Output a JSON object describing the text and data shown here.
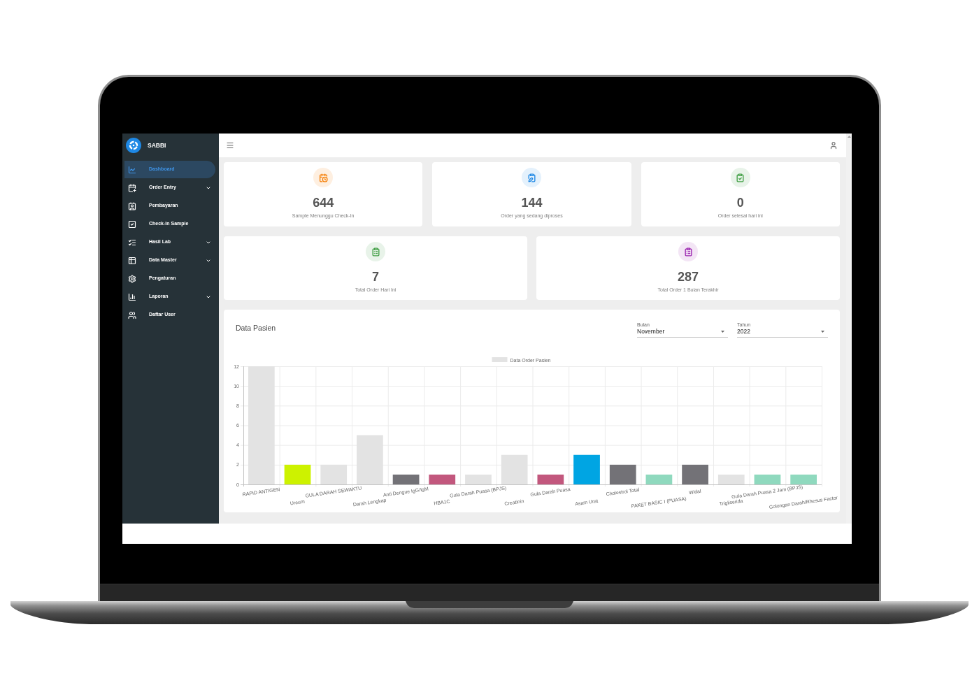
{
  "sidebar": {
    "brand": "SABBI",
    "items": [
      {
        "label": "Dashboard",
        "selected": true,
        "has_submenu": false
      },
      {
        "label": "Order Entry",
        "selected": false,
        "has_submenu": true
      },
      {
        "label": "Pembayaran",
        "selected": false,
        "has_submenu": false
      },
      {
        "label": "Check-in Sample",
        "selected": false,
        "has_submenu": false
      },
      {
        "label": "Hasil Lab",
        "selected": false,
        "has_submenu": true
      },
      {
        "label": "Data Master",
        "selected": false,
        "has_submenu": true
      },
      {
        "label": "Pengaturan",
        "selected": false,
        "has_submenu": false
      },
      {
        "label": "Laporan",
        "selected": false,
        "has_submenu": true
      },
      {
        "label": "Daftar User",
        "selected": false,
        "has_submenu": false
      }
    ]
  },
  "stat_rows": [
    {
      "cards": [
        {
          "value": "644",
          "label": "Sample Menunggu Check-In",
          "color": "#f57c00"
        },
        {
          "value": "144",
          "label": "Order yang sedang diproses",
          "color": "#1e88e5"
        },
        {
          "value": "0",
          "label": "Order selesai hari ini",
          "color": "#43a047"
        }
      ]
    },
    {
      "cards": [
        {
          "value": "7",
          "label": "Total Order Hari Ini",
          "color": "#43a047"
        },
        {
          "value": "287",
          "label": "Total Order 1 Bulan Terakhir",
          "color": "#9c27b0"
        }
      ]
    }
  ],
  "chart_panel": {
    "title": "Data Pasien",
    "filters": [
      {
        "label": "Bulan",
        "value": "November"
      },
      {
        "label": "Tahun",
        "value": "2022"
      }
    ],
    "chart_data": {
      "type": "bar",
      "categories": [
        "RAPID ANTIGEN",
        "Ureum",
        "GULA DARAH SEWAKTU",
        "Darah Lengkap",
        "Anti Dengue IgG/IgM",
        "HBA1C",
        "Gula Darah Puasa (BPJS)",
        "Creatinin",
        "Gula Darah Puasa",
        "Asam Urat",
        "Cholestrol Total",
        "PAKET BASIC I (PUASA)",
        "Widal",
        "Trigliserida",
        "Gula Darah Puasa 2 Jam (BPJS)",
        "Golongan Darah/Rhesus Factor"
      ],
      "series": [
        {
          "name": "Data Order Pasien",
          "color": "#e3e3e3",
          "colors": [
            "#e3e3e3",
            "#cdf200",
            "#e3e3e3",
            "#e3e3e3",
            "#737277",
            "#c2577d",
            "#e3e3e3",
            "#e3e3e3",
            "#c2577d",
            "#00a5e3",
            "#737277",
            "#8fd9be",
            "#737277",
            "#e3e3e3",
            "#8fd9be",
            "#8fd9be"
          ],
          "values": [
            12,
            2,
            2,
            5,
            1,
            1,
            1,
            3,
            1,
            3,
            2,
            1,
            2,
            1,
            1,
            1
          ]
        }
      ],
      "ylim": [
        0,
        12
      ],
      "yticks": [
        0,
        2,
        4,
        6,
        8,
        10,
        12
      ],
      "grid": true
    }
  }
}
